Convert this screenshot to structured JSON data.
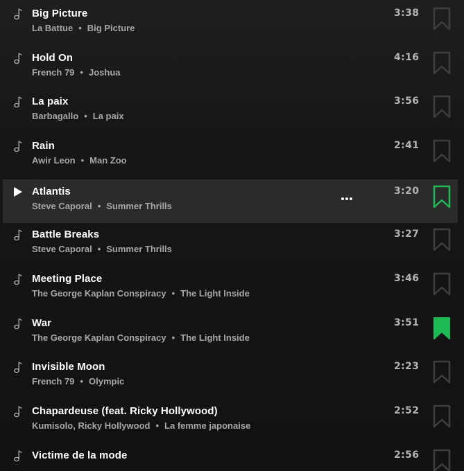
{
  "tracks": [
    {
      "title": "Big Picture",
      "artist": "La Battue",
      "album": "Big Picture",
      "duration": "3:38",
      "saved": false,
      "active": false
    },
    {
      "title": "Hold On",
      "artist": "French 79",
      "album": "Joshua",
      "duration": "4:16",
      "saved": false,
      "active": false
    },
    {
      "title": "La paix",
      "artist": "Barbagallo",
      "album": "La paix",
      "duration": "3:56",
      "saved": false,
      "active": false
    },
    {
      "title": "Rain",
      "artist": "Awir Leon",
      "album": "Man Zoo",
      "duration": "2:41",
      "saved": false,
      "active": false
    },
    {
      "title": "Atlantis",
      "artist": "Steve Caporal",
      "album": "Summer Thrills",
      "duration": "3:20",
      "saved": false,
      "active": true
    },
    {
      "title": "Battle Breaks",
      "artist": "Steve Caporal",
      "album": "Summer Thrills",
      "duration": "3:27",
      "saved": false,
      "active": false
    },
    {
      "title": "Meeting Place",
      "artist": "The George Kaplan Conspiracy",
      "album": "The Light Inside",
      "duration": "3:46",
      "saved": false,
      "active": false
    },
    {
      "title": "War",
      "artist": "The George Kaplan Conspiracy",
      "album": "The Light Inside",
      "duration": "3:51",
      "saved": true,
      "active": false
    },
    {
      "title": "Invisible Moon",
      "artist": "French 79",
      "album": "Olympic",
      "duration": "2:23",
      "saved": false,
      "active": false
    },
    {
      "title": "Chapardeuse (feat. Ricky Hollywood)",
      "artist": "Kumisolo, Ricky Hollywood",
      "album": "La femme japonaise",
      "duration": "2:52",
      "saved": false,
      "active": false
    },
    {
      "title": "Victime de la mode",
      "artist": "",
      "album": "",
      "duration": "2:56",
      "saved": false,
      "active": false
    }
  ],
  "icons": {
    "track_idle": "music-note-icon",
    "track_hover": "play-icon",
    "more": "more-options-icon",
    "save": "bookmark-icon"
  },
  "colors": {
    "accent": "#1db954",
    "bookmark_outline": "#3e3e3e",
    "active_row": "#2b2b2b",
    "secondary_text": "#a7a7a7"
  }
}
